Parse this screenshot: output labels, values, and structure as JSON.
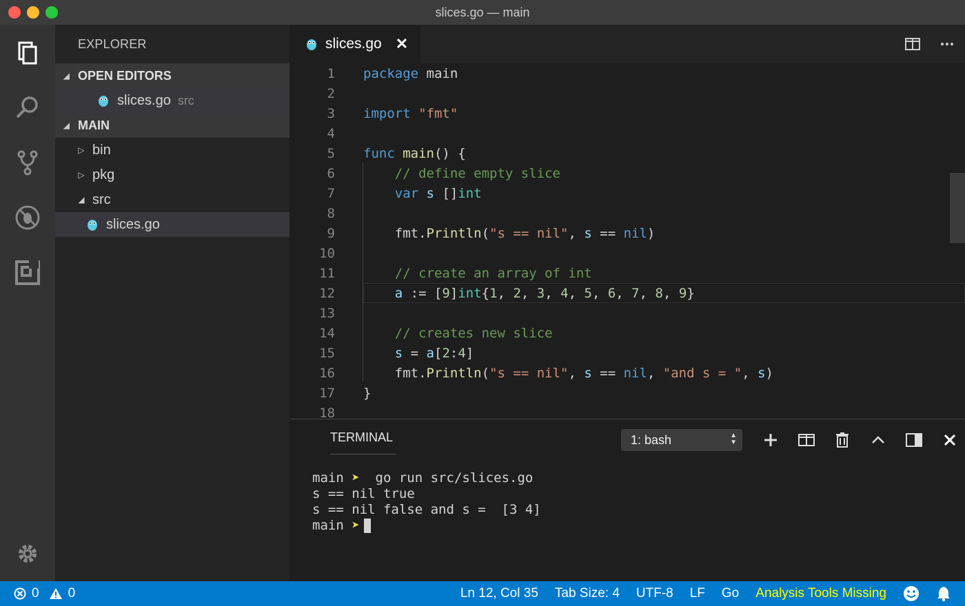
{
  "window": {
    "title": "slices.go — main"
  },
  "activity_bar": {
    "icons": [
      "files-icon",
      "search-icon",
      "source-control-icon",
      "debug-icon",
      "extensions-icon",
      "gear-icon"
    ]
  },
  "sidebar": {
    "title": "EXPLORER",
    "open_editors": {
      "header": "OPEN EDITORS",
      "items": [
        {
          "name": "slices.go",
          "folder": "src"
        }
      ]
    },
    "main": {
      "header": "MAIN",
      "folders": [
        "bin",
        "pkg",
        "src"
      ],
      "file": "slices.go"
    }
  },
  "editor": {
    "tab": {
      "label": "slices.go",
      "close": "✕"
    },
    "cursor_line": 12,
    "line_numbers": [
      "1",
      "2",
      "3",
      "4",
      "5",
      "6",
      "7",
      "8",
      "9",
      "10",
      "11",
      "12",
      "13",
      "14",
      "15",
      "16",
      "17",
      "18"
    ],
    "lines": [
      "package main",
      "",
      "import \"fmt\"",
      "",
      "func main() {",
      "    // define empty slice",
      "    var s []int",
      "",
      "    fmt.Println(\"s == nil\", s == nil)",
      "",
      "    // create an array of int",
      "    a := [9]int{1, 2, 3, 4, 5, 6, 7, 8, 9}",
      "",
      "    // creates new slice",
      "    s = a[2:4]",
      "    fmt.Println(\"s == nil\", s == nil, \"and s = \", s)",
      "}",
      ""
    ]
  },
  "panel": {
    "tab": "TERMINAL",
    "terminal_select": "1: bash",
    "output": [
      {
        "prompt": "main",
        "arrow": "➤",
        "text": "  go run src/slices.go"
      },
      {
        "text": "s == nil true"
      },
      {
        "text": "s == nil false and s =  [3 4]"
      },
      {
        "prompt": "main",
        "arrow": "➤",
        "text": ""
      }
    ]
  },
  "status_bar": {
    "errors": "0",
    "warnings": "0",
    "position": "Ln 12, Col 35",
    "tab_size": "Tab Size: 4",
    "encoding": "UTF-8",
    "eol": "LF",
    "language": "Go",
    "analysis": "Analysis Tools Missing",
    "colors": {
      "background": "#007acc",
      "analysis": "#ffff00"
    }
  }
}
